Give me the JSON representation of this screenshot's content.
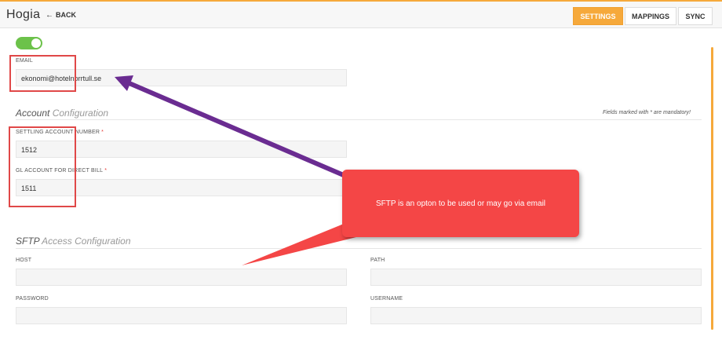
{
  "header": {
    "brand": "Hogia",
    "back_label": "BACK",
    "settings_label": "SETTINGS",
    "mappings_label": "MAPPINGS",
    "sync_label": "SYNC"
  },
  "form": {
    "email_label": "EMAIL",
    "email_value": "ekonomi@hotelnorrtull.se",
    "account_section_strong": "Account",
    "account_section_rest": "Configuration",
    "mandatory_note": "Fields marked with * are mandatory!",
    "settling_label": "SETTLING ACCOUNT NUMBER",
    "settling_value": "1512",
    "gl_label": "GL ACCOUNT FOR DIRECT BILL",
    "gl_value": "1511",
    "required_mark": "*",
    "sftp_section_strong": "SFTP",
    "sftp_section_rest": "Access Configuration",
    "host_label": "HOST",
    "path_label": "PATH",
    "password_label": "PASSWORD",
    "username_label": "USERNAME"
  },
  "annotation": {
    "callout_text": "SFTP is an opton to be used or may go via email",
    "callout_color": "#f44646",
    "arrow_color": "#6a2c91",
    "box_color": "#e04848"
  },
  "colors": {
    "accent": "#f6a93b",
    "toggle_on": "#6cc24a"
  }
}
